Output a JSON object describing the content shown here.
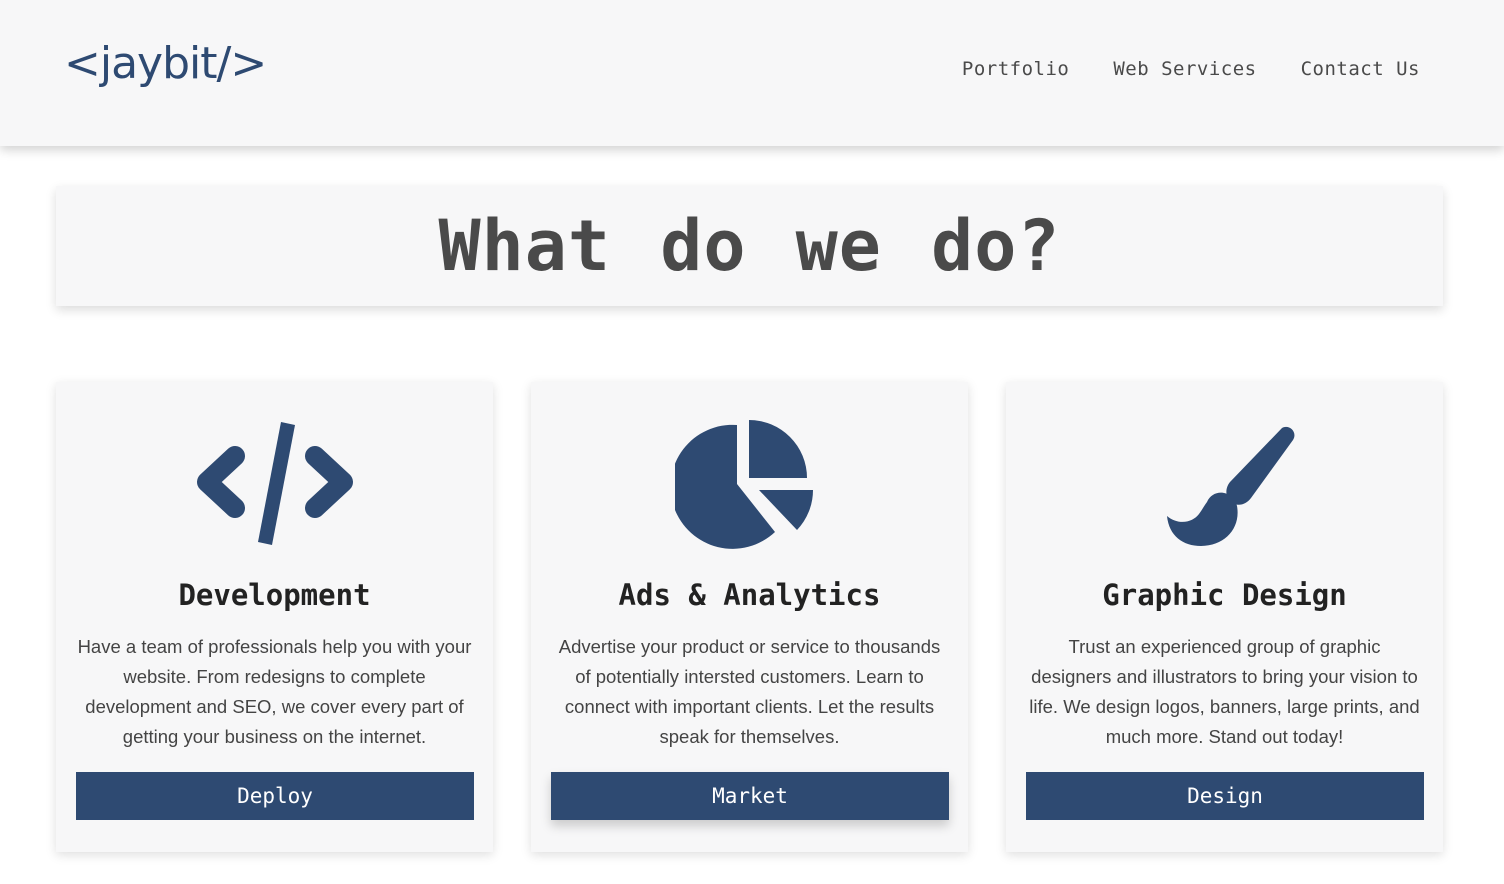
{
  "header": {
    "logo": "<jaybit/>",
    "nav": [
      "Portfolio",
      "Web Services",
      "Contact Us"
    ]
  },
  "hero": {
    "title": "What do we do?"
  },
  "cards": [
    {
      "icon": "code-icon",
      "title": "Development",
      "text": "Have a team of professionals help you with your website.  From redesigns to complete development and SEO, we cover every part of getting your business on the internet.",
      "button": "Deploy"
    },
    {
      "icon": "pie-chart-icon",
      "title": "Ads & Analytics",
      "text": "Advertise your product or service to thousands of potentially intersted customers. Learn to connect with important clients. Let the results speak for themselves.",
      "button": "Market"
    },
    {
      "icon": "paintbrush-icon",
      "title": "Graphic Design",
      "text": "Trust an experienced group of graphic designers and illustrators to bring your vision to life. We design logos, banners, large prints, and much more. Stand out today!",
      "button": "Design"
    }
  ],
  "colors": {
    "accent": "#2e4a72",
    "panel": "#f7f7f8",
    "text": "#444444"
  }
}
